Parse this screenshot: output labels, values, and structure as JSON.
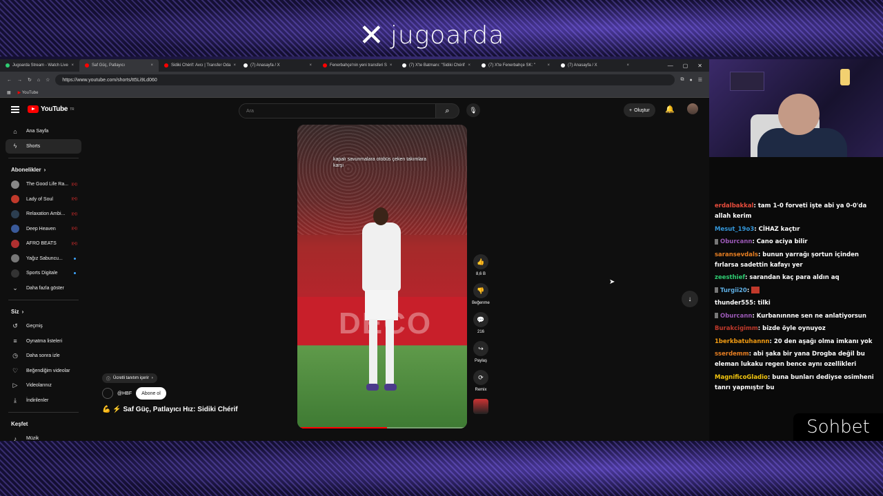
{
  "overlay": {
    "brand": "jugoarda",
    "chat_title": "Sohbet"
  },
  "browser": {
    "tabs": [
      {
        "label": "Jugoarda Stream - Watch Live",
        "color": "#2ecc71"
      },
      {
        "label": "Saf Güç, Patlayıcı",
        "color": "#ff0000"
      },
      {
        "label": "Sidiki Chérif: Avcı | Transfer Oda",
        "color": "#ff0000"
      },
      {
        "label": "(7) Anasayfa / X",
        "color": "#ffffff"
      },
      {
        "label": "Fenerbahçe'nin yeni transferi S",
        "color": "#ff0000"
      },
      {
        "label": "(7) X'te Batmanı: \"Sidiki Chérif",
        "color": "#ffffff"
      },
      {
        "label": "(7) X'te Fenerbahçe SK: \"",
        "color": "#ffffff"
      },
      {
        "label": "(7) Anasayfa / X",
        "color": "#ffffff"
      }
    ],
    "url": "https://www.youtube.com/shorts/tt5Li9Ld060",
    "bookmark": "YouTube"
  },
  "youtube": {
    "logo": "YouTube",
    "logo_region": "TR",
    "search_placeholder": "Ara",
    "create_label": "Oluştur",
    "sidebar": {
      "main": [
        {
          "label": "Ana Sayfa",
          "icon": "home-icon"
        },
        {
          "label": "Shorts",
          "icon": "shorts-icon"
        }
      ],
      "subs_header": "Abonelikler",
      "subs": [
        {
          "label": "The Good Life Ra...",
          "color": "#888888",
          "live": true
        },
        {
          "label": "Lady of Soul",
          "color": "#c0392b",
          "live": true
        },
        {
          "label": "Relaxation Ambi...",
          "color": "#2c3e50",
          "live": true
        },
        {
          "label": "Deep Heaven",
          "color": "#3a5a9a",
          "live": true
        },
        {
          "label": "AFRO BEATS",
          "color": "#b03030",
          "live": true
        },
        {
          "label": "Yağız Sabuncu...",
          "color": "#777777",
          "dot": true
        },
        {
          "label": "Sports Digitale",
          "color": "#333333",
          "dot": true
        },
        {
          "label": "Daha fazla göster",
          "icon": "chevron-down-icon"
        }
      ],
      "you_header": "Siz",
      "you": [
        {
          "label": "Geçmiş",
          "icon": "history-icon"
        },
        {
          "label": "Oynatma listeleri",
          "icon": "playlist-icon"
        },
        {
          "label": "Daha sonra izle",
          "icon": "clock-icon"
        },
        {
          "label": "Beğendiğim videolar",
          "icon": "like-icon"
        },
        {
          "label": "Videolarınız",
          "icon": "video-icon"
        },
        {
          "label": "İndirilenler",
          "icon": "download-icon"
        }
      ],
      "explore_header": "Keşfet",
      "explore": [
        {
          "label": "Müzik",
          "icon": "music-icon"
        }
      ]
    },
    "short": {
      "caption": "kapalı savunmalara otobüs çeken takımlara karşı",
      "banner_text": "DECO",
      "paid_label": "Ücretli tanıtım içerir",
      "channel": "@HBF",
      "subscribe": "Abone ol",
      "title": "💪 ⚡ Saf Güç, Patlayıcı Hız: Sidiki Chérif",
      "progress": 0.53
    },
    "actions": {
      "like_count": "8,6 B",
      "dislike_label": "Beğenme",
      "comment_count": "216",
      "share_label": "Paylaş",
      "remix_label": "Remix"
    }
  },
  "chat": [
    {
      "user": "erdalbakkal",
      "color": "#e74c3c",
      "text": ": tam 1-0 forveti işte abi ya 0-0'da allah kerim"
    },
    {
      "user": "Mesut_19o3",
      "color": "#3498db",
      "text": ": CİHAZ kaçtır"
    },
    {
      "user": "Oburcann",
      "color": "#9b59b6",
      "text": ": Cano aciya bilir",
      "badge": true
    },
    {
      "user": "saransevdals",
      "color": "#e67e22",
      "text": ": bunun yarrağı şortun içinden fırlarsa sadettin kafayı yer"
    },
    {
      "user": "zeesthief",
      "color": "#2ecc71",
      "text": ": sarandan kaç para aldın aq"
    },
    {
      "user": "Turgii20",
      "color": "#5dade2",
      "text": ":",
      "badge": true,
      "emote": true
    },
    {
      "user": "thunder555",
      "color": "#ffffff",
      "text": ": tilki"
    },
    {
      "user": "Oburcann",
      "color": "#9b59b6",
      "text": ": Kurbanınnne sen ne anlatiyorsun",
      "badge": true
    },
    {
      "user": "Burakcigimm",
      "color": "#c0392b",
      "text": ": bizde öyle oynuyoz"
    },
    {
      "user": "1berkbatuhannn",
      "color": "#f39c12",
      "text": ": 20 den aşağı olma imkanı yok"
    },
    {
      "user": "sserdemm",
      "color": "#e67e22",
      "text": ": abi şaka bir yana Drogba değil bu eleman lukaku regen bence aynı ozellikleri"
    },
    {
      "user": "MagnificoGladio",
      "color": "#f1c40f",
      "text": ": buna bunları dediyse osimheni tanrı yapmıştır bu"
    }
  ]
}
